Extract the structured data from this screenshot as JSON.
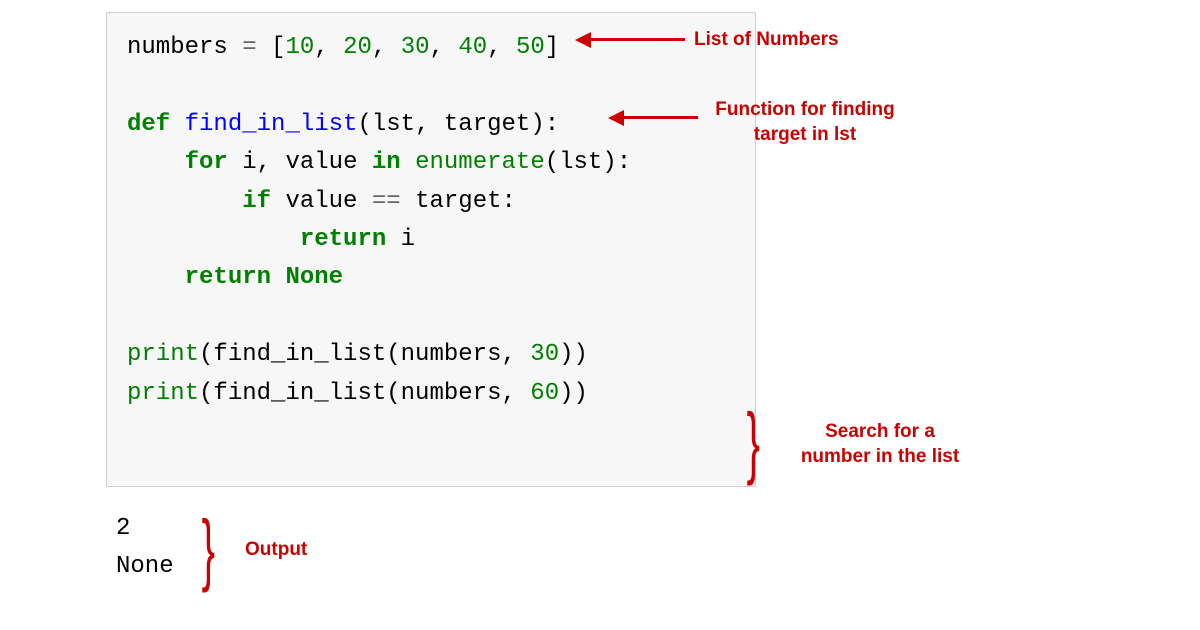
{
  "code": {
    "line1": {
      "var": "numbers",
      "eq": " = ",
      "open": "[",
      "n1": "10",
      "c1": ", ",
      "n2": "20",
      "c2": ", ",
      "n3": "30",
      "c3": ", ",
      "n4": "40",
      "c4": ", ",
      "n5": "50",
      "close": "]"
    },
    "line3": {
      "def": "def",
      "sp": " ",
      "fname": "find_in_list",
      "open": "(",
      "p1": "lst",
      "comma": ", ",
      "p2": "target",
      "close": "):"
    },
    "line4": {
      "indent": "    ",
      "for": "for",
      "sp1": " ",
      "i": "i",
      "comma": ", ",
      "val": "value",
      "sp2": " ",
      "in": "in",
      "sp3": " ",
      "enum": "enumerate",
      "open": "(",
      "lst": "lst",
      "close": "):"
    },
    "line5": {
      "indent": "        ",
      "if": "if",
      "sp1": " ",
      "val": "value",
      "sp2": " ",
      "eq": "==",
      "sp3": " ",
      "tgt": "target",
      "colon": ":"
    },
    "line6": {
      "indent": "            ",
      "ret": "return",
      "sp": " ",
      "i": "i"
    },
    "line7": {
      "indent": "    ",
      "ret": "return",
      "sp": " ",
      "none": "None"
    },
    "line9": {
      "print": "print",
      "open": "(",
      "fn": "find_in_list",
      "open2": "(",
      "arg1": "numbers",
      "comma": ", ",
      "arg2": "30",
      "close": "))"
    },
    "line10": {
      "print": "print",
      "open": "(",
      "fn": "find_in_list",
      "open2": "(",
      "arg1": "numbers",
      "comma": ", ",
      "arg2": "60",
      "close": "))"
    }
  },
  "output": {
    "line1": "2",
    "line2": "None"
  },
  "annotations": {
    "list": "List of Numbers",
    "function_l1": "Function for finding",
    "function_l2": "target in lst",
    "search_l1": "Search for a",
    "search_l2": "number in the list",
    "output": "Output"
  }
}
